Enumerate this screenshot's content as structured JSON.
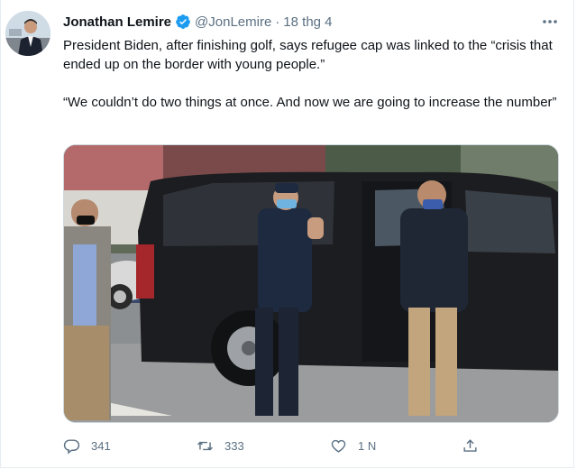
{
  "tweet": {
    "author": {
      "display_name": "Jonathan Lemire",
      "handle": "@JonLemire",
      "verified_icon": "verified-badge-icon"
    },
    "separator": "·",
    "date": "18 thg 4",
    "more_icon": "more-options-icon",
    "text": {
      "paragraph_1": "President Biden, after finishing golf, says refugee cap was linked to the “crisis that ended up on the border with young people.”",
      "paragraph_2": "“We couldn’t do two things at once. And now we are going to increase the number”"
    },
    "media": {
      "type": "photo"
    },
    "actions": {
      "reply": {
        "icon": "reply-icon",
        "count": "341"
      },
      "retweet": {
        "icon": "retweet-icon",
        "count": "333"
      },
      "like": {
        "icon": "like-icon",
        "count": "1 N"
      },
      "share": {
        "icon": "share-icon"
      }
    }
  },
  "colors": {
    "text_primary": "#0f1419",
    "text_secondary": "#5b7083",
    "verified_blue": "#1d9bf0",
    "border": "#e6ecf0"
  }
}
